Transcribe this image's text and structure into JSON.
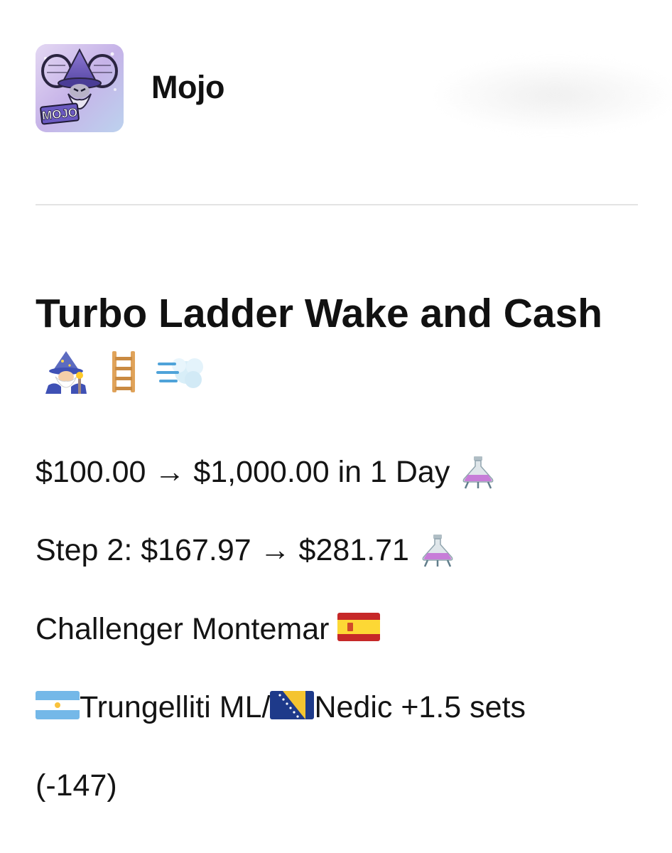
{
  "header": {
    "author_name": "Mojo",
    "avatar": {
      "icon": "wizard-logo",
      "text": "MOJO"
    }
  },
  "post": {
    "title": "Turbo Ladder Wake and Cash",
    "title_emojis": [
      "wizard-emoji",
      "ladder-emoji",
      "dash-wind-emoji"
    ],
    "lines": [
      {
        "text": "$100.00 → $1,000.00 in 1 Day",
        "icon": "flask-emoji"
      },
      {
        "text": "Step 2: $167.97 → $281.71",
        "icon": "flask-emoji"
      },
      {
        "text": "Challenger Montemar",
        "icon": "spain-flag-emoji"
      }
    ],
    "pick": {
      "player1": "Trungelliti ML/",
      "player1_flag": "argentina-flag-emoji",
      "player2": "Nedic +1.5 sets",
      "player2_flag": "bosnia-flag-emoji",
      "odds": "(-147)"
    }
  },
  "colors": {
    "text": "#111111",
    "divider": "#e3e3e3",
    "background": "#ffffff"
  }
}
